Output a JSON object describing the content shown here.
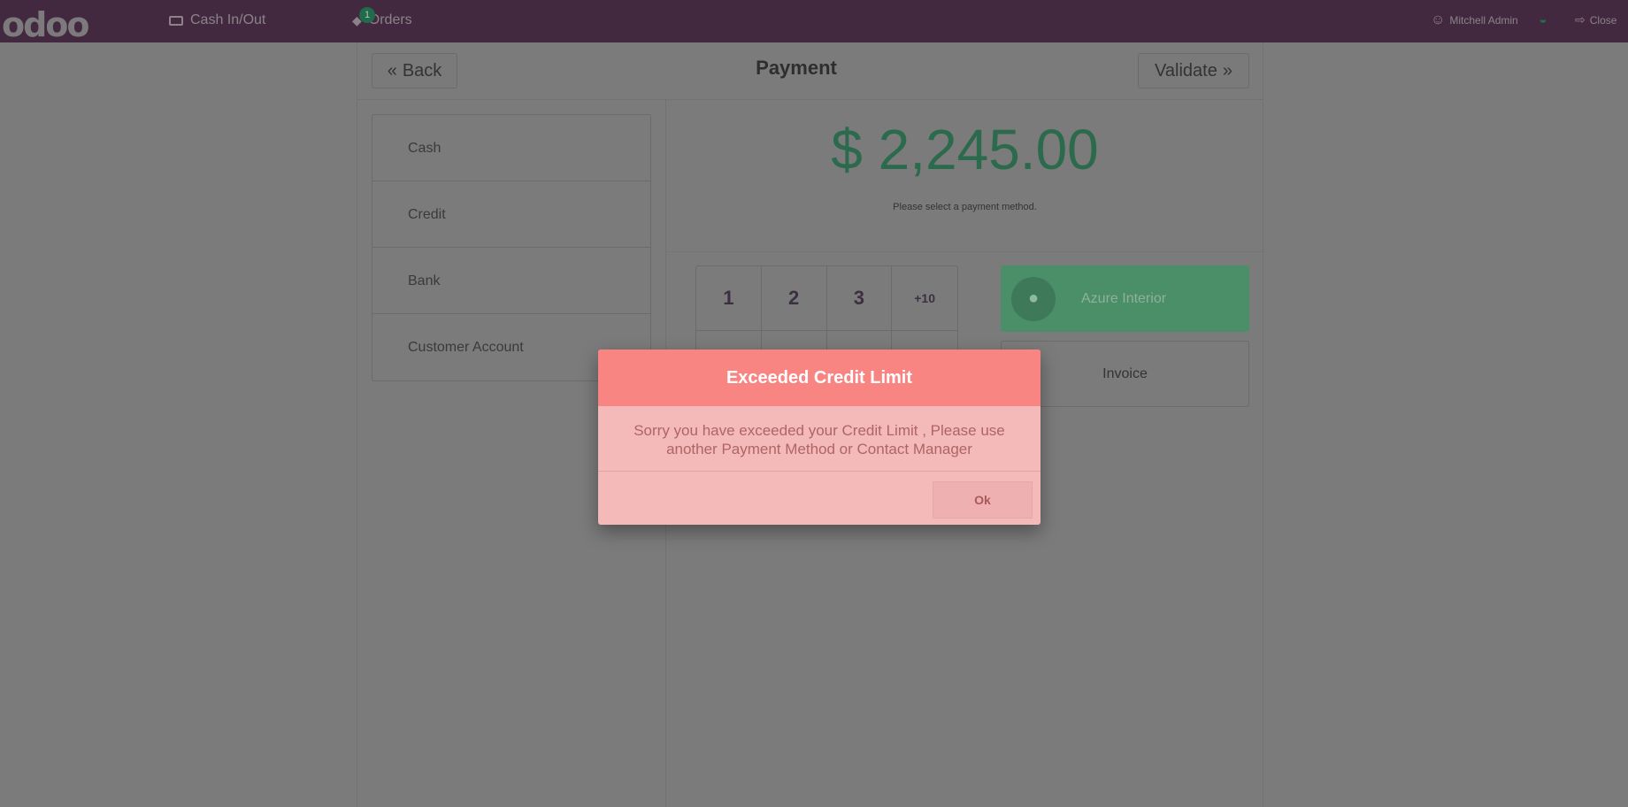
{
  "header": {
    "logo": "odoo",
    "cash_in_out": "Cash In/Out",
    "orders": "Orders",
    "orders_badge": "1",
    "user": "Mitchell Admin",
    "close": "Close",
    "wifi_color": "#1f6b4a"
  },
  "payment": {
    "back": "Back",
    "title": "Payment",
    "validate": "Validate",
    "methods": [
      "Cash",
      "Credit",
      "Bank",
      "Customer Account"
    ],
    "amount": "$ 2,245.00",
    "hint": "Please select a payment method.",
    "keys": [
      "1",
      "2",
      "3",
      "+10",
      "",
      "",
      "",
      "",
      "",
      "",
      "",
      "",
      "",
      "",
      "",
      ""
    ],
    "customer": "Azure Interior",
    "invoice": "Invoice"
  },
  "dialog": {
    "title": "Exceeded Credit Limit",
    "message": "Sorry you have exceeded your Credit Limit , Please use another Payment Method or Contact Manager",
    "ok": "Ok",
    "header_color": "#f98583"
  }
}
